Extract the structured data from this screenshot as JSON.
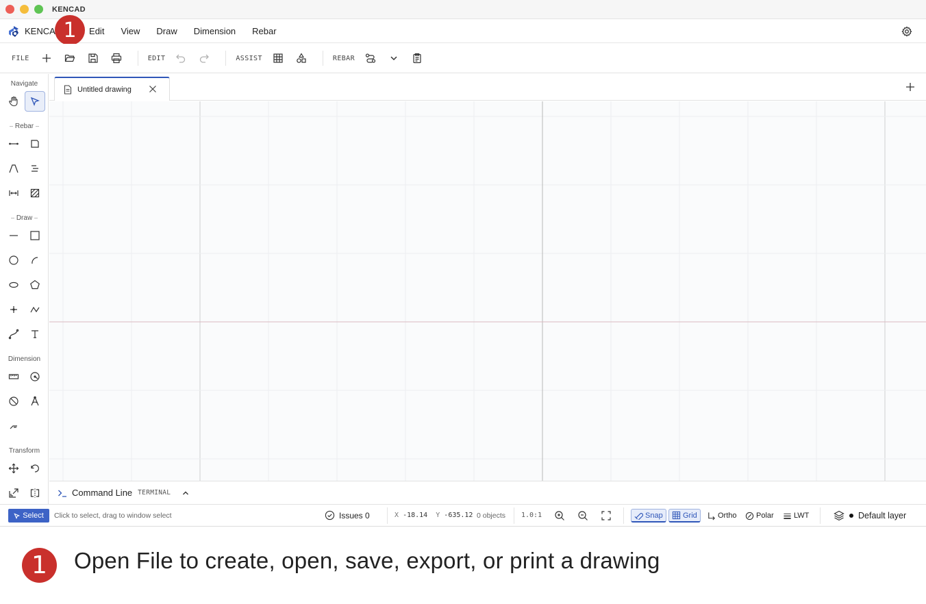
{
  "window": {
    "title": "KENCAD"
  },
  "menubar": {
    "brand": "KENCA",
    "items": [
      {
        "label": "e"
      },
      {
        "label": "Edit"
      },
      {
        "label": "View"
      },
      {
        "label": "Draw"
      },
      {
        "label": "Dimension"
      },
      {
        "label": "Rebar"
      }
    ]
  },
  "toolbar": {
    "file_label": "FILE",
    "edit_label": "EDIT",
    "assist_label": "ASSIST",
    "rebar_label": "REBAR"
  },
  "sidebar": {
    "navigate_label": "Navigate",
    "rebar_label": "Rebar",
    "draw_label": "Draw",
    "dimension_label": "Dimension",
    "transform_label": "Transform"
  },
  "tabs": [
    {
      "label": "Untitled drawing"
    }
  ],
  "command_line": {
    "title": "Command Line",
    "tag": "TERMINAL"
  },
  "status": {
    "mode": "Select",
    "hint": "Click to select, drag to window select",
    "issues": "Issues 0",
    "x_label": "X",
    "x_value": "-18.14",
    "y_label": "Y",
    "y_value": "-635.12",
    "objects": "0 objects",
    "scale": "1.0:1",
    "snap": "Snap",
    "grid": "Grid",
    "ortho": "Ortho",
    "polar": "Polar",
    "lwt": "LWT",
    "layer": "Default layer"
  },
  "tutorial": {
    "step": "1",
    "text": "Open File to create, open, save, export, or print a drawing"
  },
  "colors": {
    "accent": "#2f56b8",
    "badge": "#c9302c",
    "axis_x": "#d9b9bf",
    "axis_y": "#b8b8b8"
  }
}
